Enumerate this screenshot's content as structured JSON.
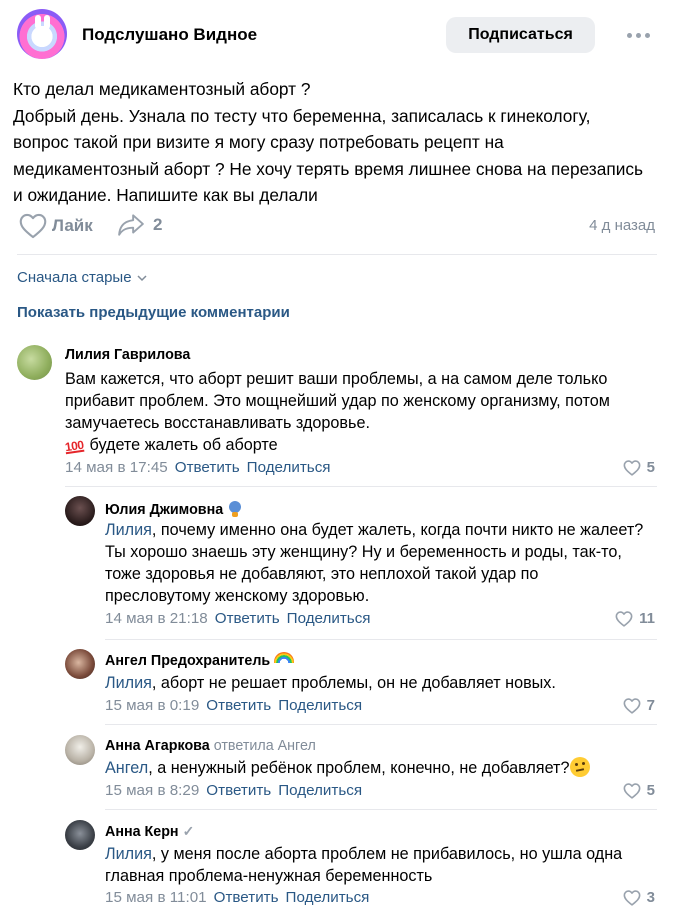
{
  "group": {
    "name": "Подслушано Видное",
    "subscribe_label": "Подписаться"
  },
  "post": {
    "lines": [
      "Кто делал медикаментозный аборт ?",
      "Добрый день. Узнала по тесту что беременна, записалась к гинекологу,",
      "вопрос такой при визите я могу сразу потребовать рецепт на",
      "медикаментозный аборт ? Не хочу терять время лишнее снова на перезапись",
      "и ожидание. Напишите как вы делали"
    ],
    "like_label": "Лайк",
    "share_count": "2",
    "date": "4 д назад"
  },
  "comments_bar": {
    "sort_label": "Сначала старые",
    "show_previous": "Показать предыдущие комментарии"
  },
  "actions": {
    "reply": "Ответить",
    "share": "Поделиться"
  },
  "comments": [
    {
      "author": "Лилия Гаврилова",
      "lines": [
        "Вам кажется, что аборт решит ваши проблемы, а на самом деле только",
        "прибавит проблем. Это мощнейший удар по женскому организму, потом",
        "замучаетесь восстанавливать здоровье."
      ],
      "last_line": "будете жалеть об аборте",
      "emoji": "100",
      "date": "14 мая в 17:45",
      "likes": "5"
    },
    {
      "author": "Юлия Джимовна",
      "mention": "Лилия",
      "lines": [
        ", почему именно она будет жалеть, когда почти никто не жалеет?",
        "Ты хорошо знаешь эту женщину? Ну и беременность и роды, так-то,",
        "тоже здоровья не добавляют, это неплохой такой удар по",
        "пресловутому женскому здоровью."
      ],
      "date": "14 мая в 21:18",
      "likes": "11"
    },
    {
      "author": "Ангел Предохранитель",
      "mention": "Лилия",
      "lines": [
        ", аборт не решает проблемы, он не добавляет новых."
      ],
      "date": "15 мая в 0:19",
      "likes": "7"
    },
    {
      "author": "Анна Агаркова",
      "reply_to": "ответила Ангел",
      "mention": "Ангел",
      "lines": [
        ", а ненужный ребёнок проблем, конечно, не добавляет?"
      ],
      "date": "15 мая в 8:29",
      "likes": "5"
    },
    {
      "author": "Анна Керн",
      "mention": "Лилия",
      "lines": [
        ", у меня после аборта проблем не прибавилось, но ушла одна",
        "главная проблема-ненужная беременность"
      ],
      "date": "15 мая в 11:01",
      "likes": "3"
    }
  ],
  "colors": {
    "link": "#2a5885",
    "secondary": "#818c99",
    "divider": "#e7e8ec",
    "button_bg": "#eceef1"
  }
}
